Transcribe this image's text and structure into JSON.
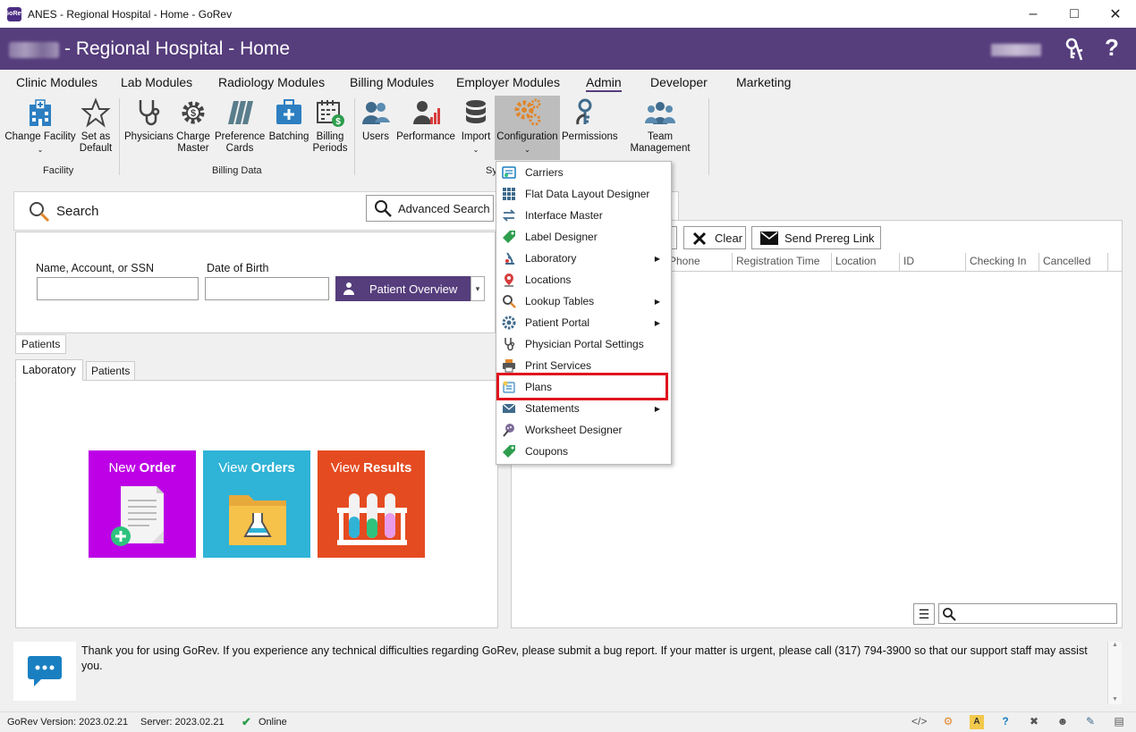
{
  "window": {
    "title": "ANES - Regional Hospital - Home - GoRev",
    "app_logo_text": "GoRev"
  },
  "header": {
    "page_title": "- Regional Hospital - Home",
    "help": "?"
  },
  "menu_tabs": [
    "Clinic Modules",
    "Lab Modules",
    "Radiology Modules",
    "Billing Modules",
    "Employer Modules",
    "Admin",
    "Developer",
    "Marketing"
  ],
  "active_tab": "Admin",
  "ribbon": {
    "buttons": [
      {
        "label": "Change Facility",
        "icon": "hospital-icon"
      },
      {
        "label": "Set as Default",
        "icon": "star-icon"
      },
      {
        "label": "Physicians",
        "icon": "stethoscope-icon"
      },
      {
        "label": "Charge Master",
        "icon": "gear-dollar-icon"
      },
      {
        "label": "Preference Cards",
        "icon": "cards-icon"
      },
      {
        "label": "Batching",
        "icon": "medical-kit-icon"
      },
      {
        "label": "Billing Periods",
        "icon": "calendar-dollar-icon"
      },
      {
        "label": "Users",
        "icon": "users-icon"
      },
      {
        "label": "Performance",
        "icon": "performance-icon"
      },
      {
        "label": "Import",
        "icon": "database-icon"
      },
      {
        "label": "Configuration",
        "icon": "gears-icon"
      },
      {
        "label": "Permissions",
        "icon": "permissions-icon"
      },
      {
        "label": "Team Management",
        "icon": "team-icon"
      }
    ],
    "groups": [
      "Facility",
      "Billing Data",
      "Sy"
    ]
  },
  "search": {
    "label": "Search",
    "advanced_label": "Advanced Search"
  },
  "form": {
    "name_label": "Name, Account, or SSN",
    "dob_label": "Date of Birth",
    "name_value": "",
    "dob_value": "",
    "overview_label": "Patient Overview"
  },
  "subtabs": {
    "patients": "Patients",
    "laboratory": "Laboratory",
    "patients2": "Patients"
  },
  "tiles": [
    {
      "pre": "New ",
      "bold": "Order",
      "color": "#bd00e6"
    },
    {
      "pre": "View ",
      "bold": "Orders",
      "color": "#2fb3d6"
    },
    {
      "pre": "View ",
      "bold": "Results",
      "color": "#e54b21"
    }
  ],
  "right_panel": {
    "clear_label": "Clear",
    "prereg_label": "Send Prereg Link",
    "columns": [
      "Phone",
      "Registration Time",
      "Location",
      "ID",
      "Checking In",
      "Cancelled"
    ]
  },
  "dropdown": {
    "items": [
      {
        "label": "Carriers",
        "icon": "carriers-icon",
        "submenu": false
      },
      {
        "label": "Flat Data Layout Designer",
        "icon": "grid-icon",
        "submenu": false
      },
      {
        "label": "Interface Master",
        "icon": "interface-arrows-icon",
        "submenu": false
      },
      {
        "label": "Label Designer",
        "icon": "label-tag-icon",
        "submenu": false
      },
      {
        "label": "Laboratory",
        "icon": "microscope-icon",
        "submenu": true
      },
      {
        "label": "Locations",
        "icon": "map-pin-icon",
        "submenu": false
      },
      {
        "label": "Lookup Tables",
        "icon": "magnifier-icon",
        "submenu": true
      },
      {
        "label": "Patient Portal",
        "icon": "portal-gear-icon",
        "submenu": true
      },
      {
        "label": "Physician Portal Settings",
        "icon": "stethoscope-icon",
        "submenu": false
      },
      {
        "label": "Print Services",
        "icon": "printer-icon",
        "submenu": false
      },
      {
        "label": "Plans",
        "icon": "plans-icon",
        "submenu": false
      },
      {
        "label": "Statements",
        "icon": "envelope-icon",
        "submenu": true
      },
      {
        "label": "Worksheet Designer",
        "icon": "worksheet-icon",
        "submenu": false
      },
      {
        "label": "Coupons",
        "icon": "coupon-tag-icon",
        "submenu": false
      }
    ],
    "highlighted": "Plans"
  },
  "message": "Thank you for using GoRev.  If you experience any technical difficulties regarding GoRev, please submit a bug report.  If your matter is urgent, please call (317) 794-3900 so that our support staff may assist you.",
  "status": {
    "version": "GoRev Version: 2023.02.21",
    "server": "Server: 2023.02.21",
    "online": "Online"
  },
  "colors": {
    "brand": "#563d7c",
    "highlight": "#e0141e"
  }
}
